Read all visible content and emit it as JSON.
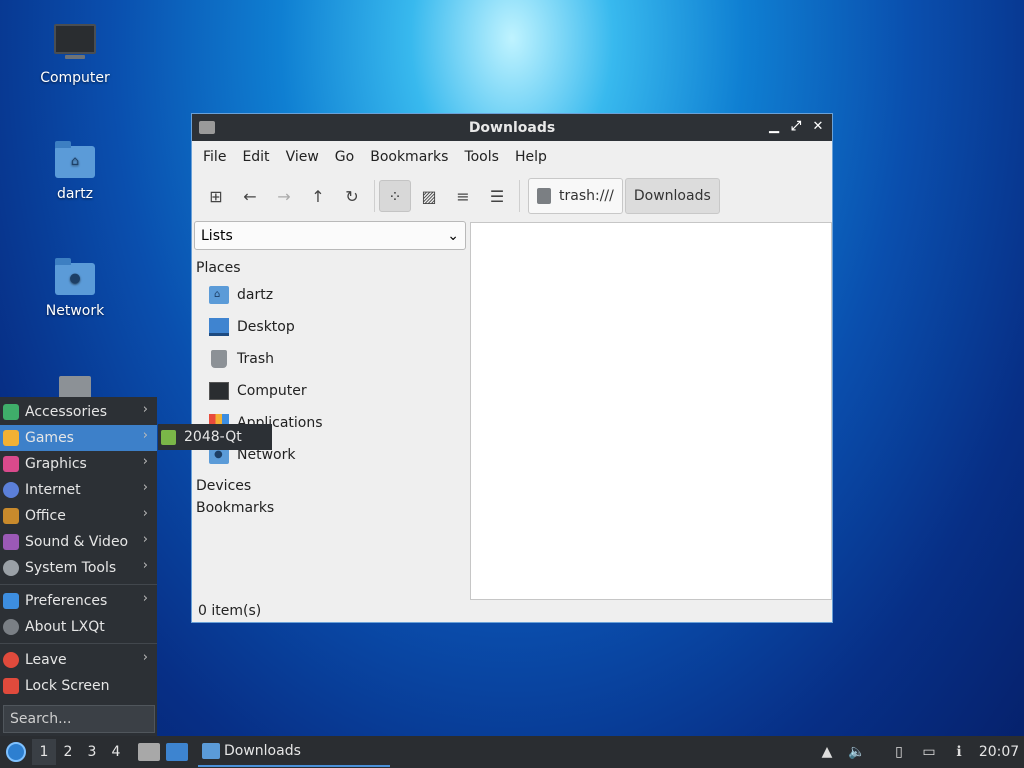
{
  "desktop": {
    "icons": [
      {
        "label": "Computer"
      },
      {
        "label": "dartz"
      },
      {
        "label": "Network"
      }
    ]
  },
  "window": {
    "title": "Downloads",
    "controls": {
      "minimize": "▁",
      "maximize": "⤢",
      "close": "✕"
    },
    "menu": [
      "File",
      "Edit",
      "View",
      "Go",
      "Bookmarks",
      "Tools",
      "Help"
    ],
    "toolbar_icons": [
      "new-tab-icon",
      "back-icon",
      "forward-icon",
      "up-icon",
      "reload-icon",
      "icon-view-icon",
      "thumbnail-view-icon",
      "compact-view-icon",
      "detailed-list-icon"
    ],
    "path": {
      "trash": "trash:///",
      "current": "Downloads"
    },
    "side_select": "Lists",
    "places_label": "Places",
    "places": [
      "dartz",
      "Desktop",
      "Trash",
      "Computer",
      "Applications",
      "Network"
    ],
    "devices_label": "Devices",
    "bookmarks_label": "Bookmarks",
    "status": "0 item(s)"
  },
  "startmenu": {
    "items": [
      {
        "label": "Accessories",
        "color": "#3fae6a"
      },
      {
        "label": "Games",
        "color": "#f2b134"
      },
      {
        "label": "Graphics",
        "color": "#d94a8c"
      },
      {
        "label": "Internet",
        "color": "#5b7fd8"
      },
      {
        "label": "Office",
        "color": "#c98a2c"
      },
      {
        "label": "Sound & Video",
        "color": "#9b59b6"
      },
      {
        "label": "System Tools",
        "color": "#9aa0a6"
      },
      {
        "label": "Preferences",
        "color": "#3d8ee0"
      },
      {
        "label": "About LXQt",
        "color": "#7a7f85"
      },
      {
        "label": "Leave",
        "color": "#e04a3c"
      },
      {
        "label": "Lock Screen",
        "color": "#e04a3c"
      }
    ],
    "search_placeholder": "Search...",
    "submenu_item": "2048-Qt"
  },
  "taskbar": {
    "desktops": [
      "1",
      "2",
      "3",
      "4"
    ],
    "task": "Downloads",
    "clock": "20:07"
  }
}
